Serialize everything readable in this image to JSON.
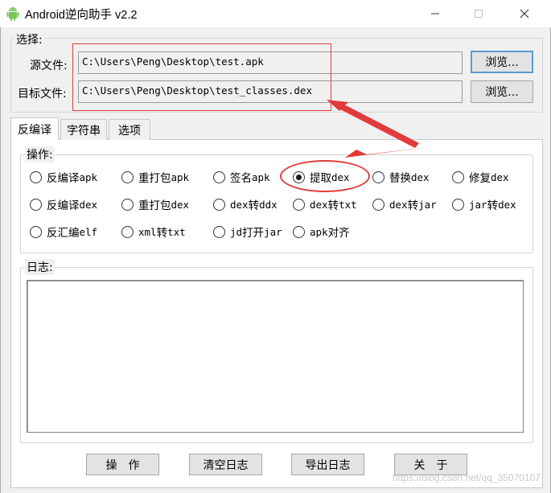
{
  "window": {
    "title": "Android逆向助手 v2.2",
    "minimize_icon": "minimize-icon",
    "maximize_icon": "maximize-icon",
    "close_icon": "close-icon"
  },
  "select_group": {
    "label": "选择:",
    "source_label": "源文件:",
    "source_value": "C:\\Users\\Peng\\Desktop\\test.apk",
    "target_label": "目标文件:",
    "target_value": "C:\\Users\\Peng\\Desktop\\test_classes.dex",
    "browse_label": "浏览..."
  },
  "tabs": [
    {
      "label": "反编译",
      "active": true
    },
    {
      "label": "字符串",
      "active": false
    },
    {
      "label": "选项",
      "active": false
    }
  ],
  "operation_group": {
    "label": "操作:",
    "options": [
      {
        "cn": "反编译",
        "en": "apk",
        "selected": false
      },
      {
        "cn": "重打包",
        "en": "apk",
        "selected": false
      },
      {
        "cn": "签名",
        "en": "apk",
        "selected": false
      },
      {
        "cn": "提取",
        "en": "dex",
        "selected": true
      },
      {
        "cn": "替换",
        "en": "dex",
        "selected": false
      },
      {
        "cn": "修复",
        "en": "dex",
        "selected": false
      },
      {
        "cn": "反编译",
        "en": "dex",
        "selected": false
      },
      {
        "cn": "重打包",
        "en": "dex",
        "selected": false
      },
      {
        "pre": "dex",
        "cn": "转",
        "en": "ddx",
        "selected": false
      },
      {
        "pre": "dex",
        "cn": "转",
        "en": "txt",
        "selected": false
      },
      {
        "pre": "dex",
        "cn": "转",
        "en": "jar",
        "selected": false
      },
      {
        "pre": "jar",
        "cn": "转",
        "en": "dex",
        "selected": false
      },
      {
        "cn": "反汇编",
        "en": "elf",
        "selected": false
      },
      {
        "pre": "xml",
        "cn": "转",
        "en": "txt",
        "selected": false
      },
      {
        "pre": "jd",
        "cn": "打开",
        "en": "jar",
        "selected": false
      },
      {
        "pre": "apk",
        "cn": "对齐",
        "en": "",
        "selected": false
      }
    ]
  },
  "log_group": {
    "label": "日志:",
    "content": ""
  },
  "buttons": {
    "operate": "操　作",
    "clear_log": "清空日志",
    "export_log": "导出日志",
    "about": "关　于"
  },
  "watermark": "https://blog.csdn.net/qq_35070107",
  "colors": {
    "annotation_red": "#e23b3b",
    "android_green": "#78c257"
  }
}
